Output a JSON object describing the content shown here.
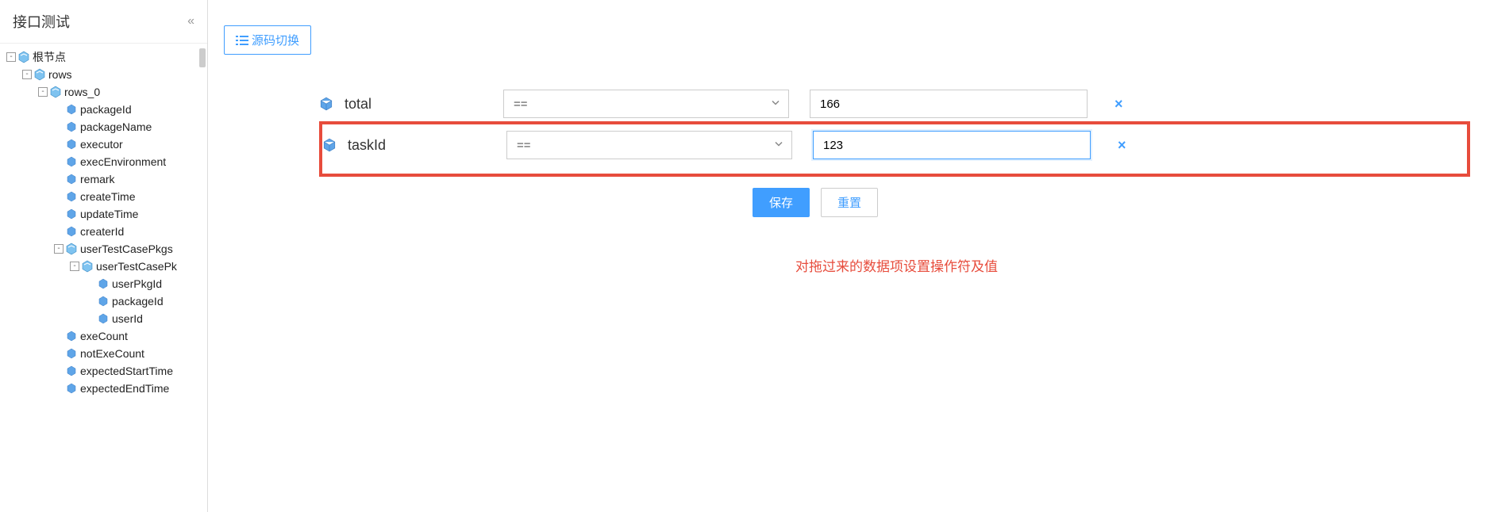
{
  "sidebar": {
    "title": "接口测试",
    "tree": [
      {
        "indent": 0,
        "toggle": "-",
        "icon": "folder",
        "label": "根节点"
      },
      {
        "indent": 1,
        "toggle": "-",
        "icon": "folder",
        "label": "rows"
      },
      {
        "indent": 2,
        "toggle": "-",
        "icon": "folder",
        "label": "rows_0"
      },
      {
        "indent": 3,
        "toggle": "",
        "icon": "leaf",
        "label": "packageId"
      },
      {
        "indent": 3,
        "toggle": "",
        "icon": "leaf",
        "label": "packageName"
      },
      {
        "indent": 3,
        "toggle": "",
        "icon": "leaf",
        "label": "executor"
      },
      {
        "indent": 3,
        "toggle": "",
        "icon": "leaf",
        "label": "execEnvironment"
      },
      {
        "indent": 3,
        "toggle": "",
        "icon": "leaf",
        "label": "remark"
      },
      {
        "indent": 3,
        "toggle": "",
        "icon": "leaf",
        "label": "createTime"
      },
      {
        "indent": 3,
        "toggle": "",
        "icon": "leaf",
        "label": "updateTime"
      },
      {
        "indent": 3,
        "toggle": "",
        "icon": "leaf",
        "label": "createrId"
      },
      {
        "indent": 3,
        "toggle": "-",
        "icon": "folder",
        "label": "userTestCasePkgs"
      },
      {
        "indent": 4,
        "toggle": "-",
        "icon": "folder",
        "label": "userTestCasePk"
      },
      {
        "indent": 5,
        "toggle": "",
        "icon": "leaf",
        "label": "userPkgId"
      },
      {
        "indent": 5,
        "toggle": "",
        "icon": "leaf",
        "label": "packageId"
      },
      {
        "indent": 5,
        "toggle": "",
        "icon": "leaf",
        "label": "userId"
      },
      {
        "indent": 3,
        "toggle": "",
        "icon": "leaf",
        "label": "exeCount"
      },
      {
        "indent": 3,
        "toggle": "",
        "icon": "leaf",
        "label": "notExeCount"
      },
      {
        "indent": 3,
        "toggle": "",
        "icon": "leaf",
        "label": "expectedStartTime"
      },
      {
        "indent": 3,
        "toggle": "",
        "icon": "leaf",
        "label": "expectedEndTime"
      }
    ]
  },
  "main": {
    "source_toggle": "源码切换",
    "rows": [
      {
        "label": "total",
        "operator": "==",
        "value": "166"
      },
      {
        "label": "taskId",
        "operator": "==",
        "value": "123"
      }
    ],
    "save_label": "保存",
    "reset_label": "重置",
    "annotation": "对拖过来的数据项设置操作符及值"
  }
}
